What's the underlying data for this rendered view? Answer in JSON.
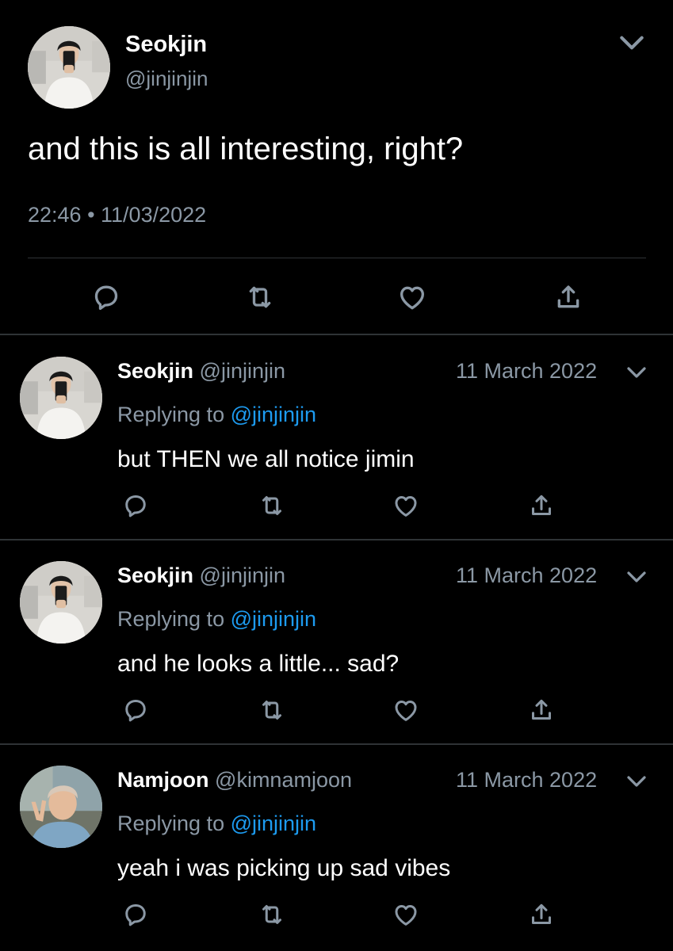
{
  "main_tweet": {
    "name": "Seokjin",
    "handle": "@jinjinjin",
    "text": "and this is all interesting, right?",
    "timestamp": "22:46 • 11/03/2022"
  },
  "replies": [
    {
      "name": "Seokjin",
      "handle": "@jinjinjin",
      "date": "11 March 2022",
      "replying_prefix": "Replying to",
      "replying_handle": "@jinjinjin",
      "text": "but THEN we all notice jimin"
    },
    {
      "name": "Seokjin",
      "handle": "@jinjinjin",
      "date": "11 March 2022",
      "replying_prefix": "Replying to",
      "replying_handle": "@jinjinjin",
      "text": "and he looks a little... sad?"
    },
    {
      "name": "Namjoon",
      "handle": "@kimnamjoon",
      "date": "11 March 2022",
      "replying_prefix": "Replying to",
      "replying_handle": "@jinjinjin",
      "text": "yeah i was picking up sad vibes"
    }
  ],
  "icons": {
    "reply": "reply-icon",
    "retweet": "retweet-icon",
    "like": "heart-icon",
    "share": "share-icon",
    "more": "chevron-down-icon"
  },
  "colors": {
    "background": "#000000",
    "text": "#ffffff",
    "muted": "#8b98a5",
    "link": "#1d9bf0",
    "divider": "#2f3336"
  }
}
